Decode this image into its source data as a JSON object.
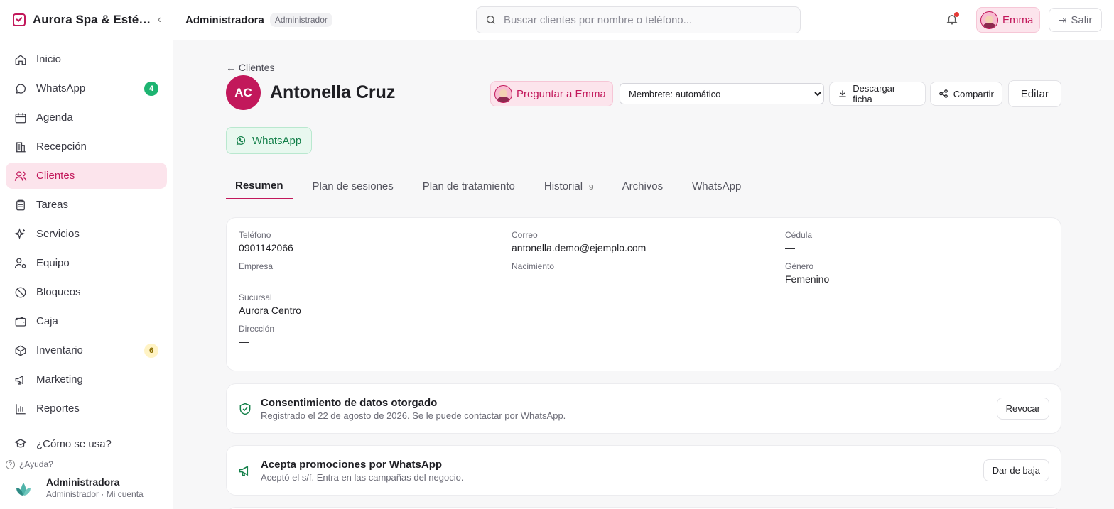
{
  "sidebar": {
    "brand": "Aurora Spa & Esté…",
    "collapse_icon": "chevron-left-icon",
    "items": [
      {
        "label": "Inicio",
        "icon": "home-icon"
      },
      {
        "label": "WhatsApp",
        "icon": "chat-icon",
        "badge": "4"
      },
      {
        "label": "Agenda",
        "icon": "calendar-icon"
      },
      {
        "label": "Recepción",
        "icon": "building-icon"
      },
      {
        "label": "Clientes",
        "icon": "users-icon",
        "active": true
      },
      {
        "label": "Tareas",
        "icon": "clipboard-icon"
      },
      {
        "label": "Servicios",
        "icon": "sparkles-icon"
      },
      {
        "label": "Equipo",
        "icon": "user-gear-icon"
      },
      {
        "label": "Bloqueos",
        "icon": "ban-icon"
      },
      {
        "label": "Caja",
        "icon": "wallet-icon"
      },
      {
        "label": "Inventario",
        "icon": "box-icon",
        "badge": "6"
      },
      {
        "label": "Marketing",
        "icon": "megaphone-icon"
      },
      {
        "label": "Reportes",
        "icon": "bar-chart-icon"
      }
    ],
    "howto": "¿Cómo se usa?",
    "help": "¿Ayuda?",
    "user_name": "Administradora",
    "user_sub": "Administrador · Mi cuenta"
  },
  "topbar": {
    "role_name": "Administradora",
    "role_tag": "Administrador",
    "search_placeholder": "Buscar clientes por nombre o teléfono...",
    "assistant": "Emma",
    "exit": "Salir"
  },
  "client": {
    "back": "← Clientes",
    "initials": "AC",
    "name": "Antonella Cruz",
    "ask": "Preguntar a Emma",
    "select_value": "Membrete: automático",
    "download": "Descargar ficha",
    "share": "Compartir",
    "edit": "Editar",
    "whatsapp": "WhatsApp"
  },
  "tabs": [
    {
      "label": "Resumen",
      "active": true
    },
    {
      "label": "Plan de sesiones"
    },
    {
      "label": "Plan de tratamiento"
    },
    {
      "label": "Historial",
      "count": "9"
    },
    {
      "label": "Archivos"
    },
    {
      "label": "WhatsApp"
    }
  ],
  "fields": [
    {
      "label": "Teléfono",
      "value": "0901142066"
    },
    {
      "label": "Correo",
      "value": "antonella.demo@ejemplo.com"
    },
    {
      "label": "Cédula",
      "value": "—"
    },
    {
      "label": "Empresa",
      "value": "—"
    },
    {
      "label": "Nacimiento",
      "value": "—"
    },
    {
      "label": "Género",
      "value": "Femenino"
    },
    {
      "label": "Sucursal",
      "value": "Aurora Centro"
    },
    {
      "label": "",
      "value": ""
    },
    {
      "label": "",
      "value": ""
    },
    {
      "label": "Dirección",
      "value": "—"
    }
  ],
  "consent": {
    "title": "Consentimiento de datos otorgado",
    "sub": "Registrado el 22 de agosto de 2026. Se le puede contactar por WhatsApp.",
    "button": "Revocar"
  },
  "promo": {
    "title": "Acepta promociones por WhatsApp",
    "sub": "Aceptó el s/f. Entra en las campañas del negocio.",
    "button": "Dar de baja"
  },
  "colors": {
    "accent": "#c2185b",
    "accent_bg": "#fce4ec",
    "success": "#14804a",
    "success_bg": "#e8f8ef"
  }
}
